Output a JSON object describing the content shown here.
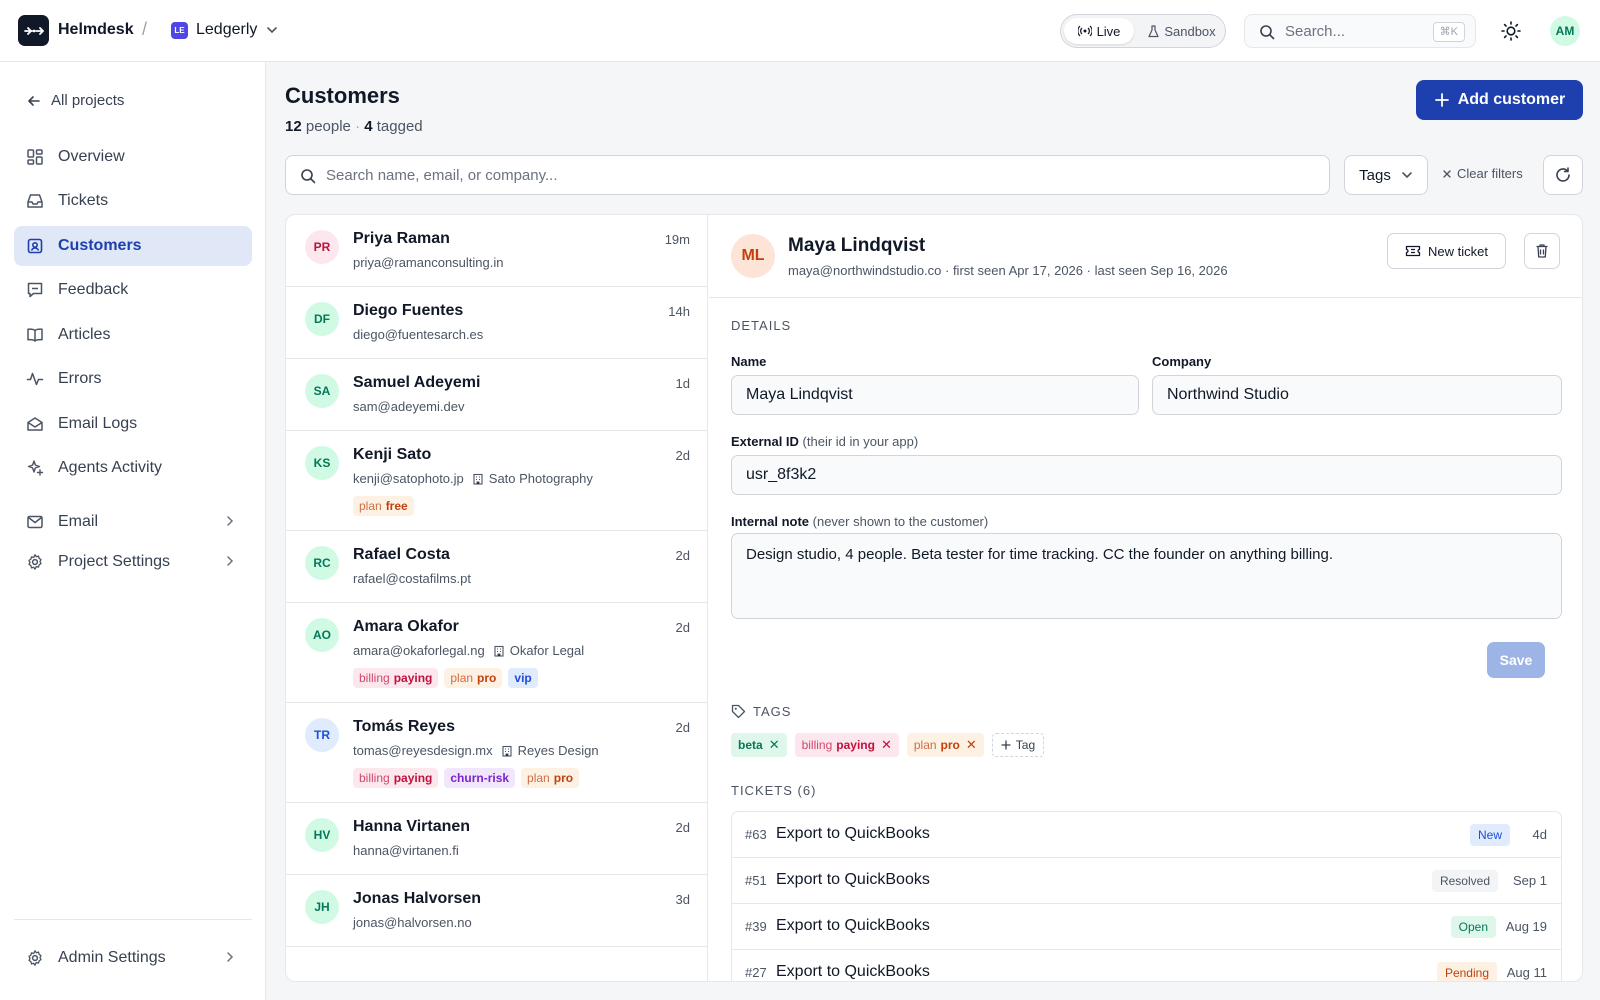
{
  "topbar": {
    "brand": "Helmdesk",
    "separator": "/",
    "project_badge": "LE",
    "project_name": "Ledgerly",
    "env_live": "Live",
    "env_sandbox": "Sandbox",
    "search_placeholder": "Search...",
    "search_shortcut": "⌘K",
    "user_initials": "AM"
  },
  "sidebar": {
    "back": "All projects",
    "items": [
      {
        "label": "Overview",
        "icon": "grid-icon"
      },
      {
        "label": "Tickets",
        "icon": "inbox-icon"
      },
      {
        "label": "Customers",
        "icon": "contact-icon",
        "active": true
      },
      {
        "label": "Feedback",
        "icon": "message-icon"
      },
      {
        "label": "Articles",
        "icon": "book-icon"
      },
      {
        "label": "Errors",
        "icon": "activity-icon"
      },
      {
        "label": "Email Logs",
        "icon": "mail-open-icon"
      },
      {
        "label": "Agents Activity",
        "icon": "sparkle-icon"
      },
      {
        "label": "Email",
        "icon": "mail-icon",
        "expandable": true
      },
      {
        "label": "Project Settings",
        "icon": "gear-icon",
        "expandable": true
      }
    ],
    "admin": "Admin Settings"
  },
  "main": {
    "title": "Customers",
    "count_people": "12",
    "people_label": "people",
    "dot": "·",
    "count_tagged": "4",
    "tagged_label": "tagged",
    "add_button": "Add customer",
    "search_placeholder": "Search name, email, or company...",
    "tags_button": "Tags",
    "clear_filters": "Clear filters"
  },
  "customers": [
    {
      "initials": "PR",
      "name": "Priya Raman",
      "time": "19m",
      "email": "priya@ramanconsulting.in",
      "company": "",
      "tags": []
    },
    {
      "initials": "DF",
      "name": "Diego Fuentes",
      "time": "14h",
      "email": "diego@fuentesarch.es",
      "company": "",
      "tags": []
    },
    {
      "initials": "SA",
      "name": "Samuel Adeyemi",
      "time": "1d",
      "email": "sam@adeyemi.dev",
      "company": "",
      "tags": []
    },
    {
      "initials": "KS",
      "name": "Kenji Sato",
      "time": "2d",
      "email": "kenji@satophoto.jp",
      "company": "Sato Photography",
      "tags": [
        {
          "key": "plan",
          "value": "free"
        }
      ]
    },
    {
      "initials": "RC",
      "name": "Rafael Costa",
      "time": "2d",
      "email": "rafael@costafilms.pt",
      "company": "",
      "tags": []
    },
    {
      "initials": "AO",
      "name": "Amara Okafor",
      "time": "2d",
      "email": "amara@okaforlegal.ng",
      "company": "Okafor Legal",
      "tags": [
        {
          "key": "billing",
          "value": "paying"
        },
        {
          "key": "plan",
          "value": "pro"
        },
        {
          "key": "",
          "value": "vip"
        }
      ]
    },
    {
      "initials": "TR",
      "name": "Tomás Reyes",
      "time": "2d",
      "email": "tomas@reyesdesign.mx",
      "company": "Reyes Design",
      "tags": [
        {
          "key": "billing",
          "value": "paying"
        },
        {
          "key": "",
          "value": "churn-risk"
        },
        {
          "key": "plan",
          "value": "pro"
        }
      ]
    },
    {
      "initials": "HV",
      "name": "Hanna Virtanen",
      "time": "2d",
      "email": "hanna@virtanen.fi",
      "company": "",
      "tags": []
    },
    {
      "initials": "JH",
      "name": "Jonas Halvorsen",
      "time": "3d",
      "email": "jonas@halvorsen.no",
      "company": "",
      "tags": []
    }
  ],
  "detail": {
    "initials": "ML",
    "name": "Maya Lindqvist",
    "meta": "maya@northwindstudio.co · first seen Apr 17, 2026 · last seen Sep 16, 2026",
    "new_ticket": "New ticket",
    "details_label": "DETAILS",
    "name_label": "Name",
    "name_value": "Maya Lindqvist",
    "company_label": "Company",
    "company_value": "Northwind Studio",
    "external_id_label": "External ID",
    "external_id_hint": "(their id in your app)",
    "external_id_value": "usr_8f3k2",
    "note_label": "Internal note",
    "note_hint": "(never shown to the customer)",
    "note_value": "Design studio, 4 people. Beta tester for time tracking. CC the founder on anything billing.",
    "save": "Save",
    "tags_label": "TAGS",
    "tags": [
      {
        "key": "",
        "value": "beta"
      },
      {
        "key": "billing",
        "value": "paying"
      },
      {
        "key": "plan",
        "value": "pro"
      }
    ],
    "add_tag": "Tag",
    "tickets_label": "TICKETS (6)",
    "tickets": [
      {
        "num": "#63",
        "title": "Export to QuickBooks",
        "status": "New",
        "date": "4d"
      },
      {
        "num": "#51",
        "title": "Export to QuickBooks",
        "status": "Resolved",
        "date": "Sep 1"
      },
      {
        "num": "#39",
        "title": "Export to QuickBooks",
        "status": "Open",
        "date": "Aug 19"
      },
      {
        "num": "#27",
        "title": "Export to QuickBooks",
        "status": "Pending",
        "date": "Aug 11"
      }
    ]
  },
  "colors": {
    "accent": "#1e40af",
    "active_nav_bg": "#e0e7f6",
    "save_disabled": "#9db5e6"
  }
}
